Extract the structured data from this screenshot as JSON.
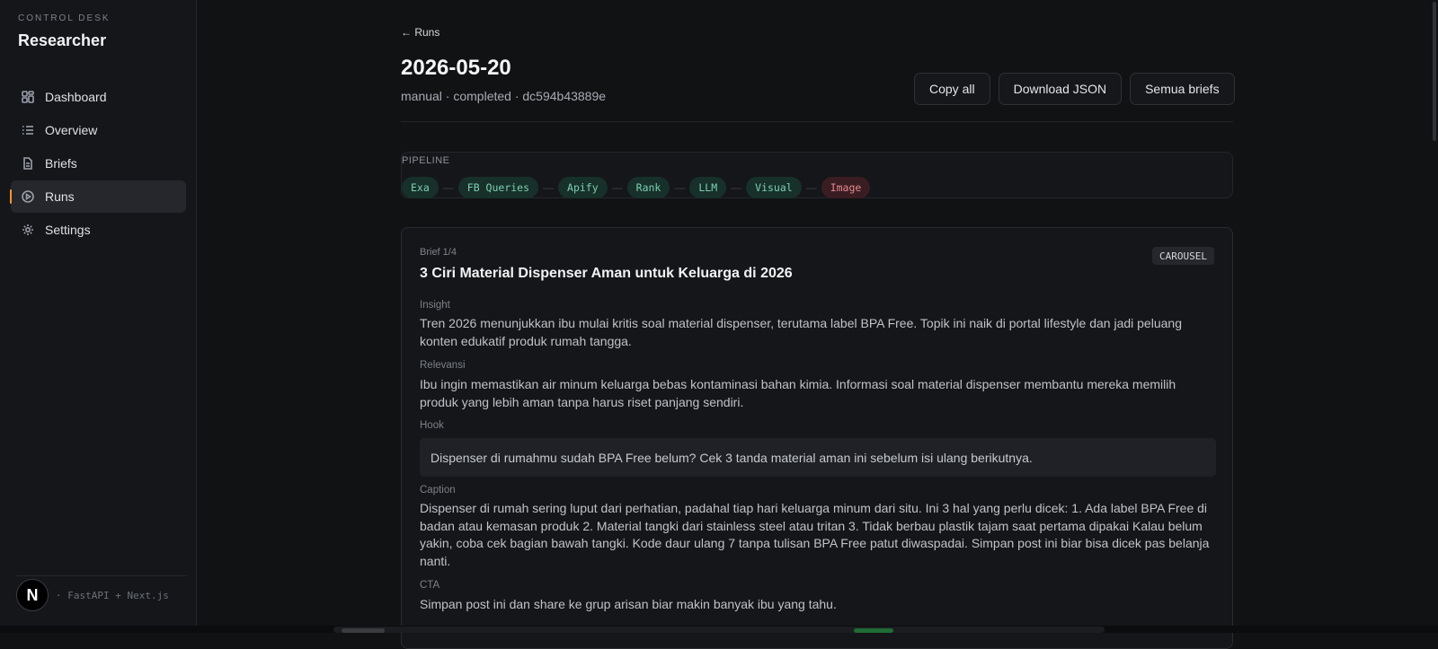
{
  "sidebar": {
    "eyebrow": "CONTROL DESK",
    "title": "Researcher",
    "items": [
      {
        "label": "Dashboard",
        "icon": "dashboard-icon",
        "active": false
      },
      {
        "label": "Overview",
        "icon": "list-icon",
        "active": false
      },
      {
        "label": "Briefs",
        "icon": "document-icon",
        "active": false
      },
      {
        "label": "Runs",
        "icon": "play-circle-icon",
        "active": true
      },
      {
        "label": "Settings",
        "icon": "gear-icon",
        "active": false
      }
    ],
    "footer_logo": "N",
    "footer_stack": "· FastAPI + Next.js"
  },
  "header": {
    "back_label": "← Runs",
    "title": "2026-05-20",
    "subtitle": "manual · completed · dc594b43889e",
    "actions": {
      "copy_all": "Copy all",
      "download_json": "Download JSON",
      "all_briefs": "Semua briefs"
    }
  },
  "pipeline": {
    "label": "PIPELINE",
    "steps": [
      {
        "label": "Exa",
        "status": "ok"
      },
      {
        "label": "FB Queries",
        "status": "ok"
      },
      {
        "label": "Apify",
        "status": "ok"
      },
      {
        "label": "Rank",
        "status": "ok"
      },
      {
        "label": "LLM",
        "status": "ok"
      },
      {
        "label": "Visual",
        "status": "ok"
      },
      {
        "label": "Image",
        "status": "error"
      }
    ],
    "separator": "—"
  },
  "brief": {
    "number": "Brief 1/4",
    "format": "CAROUSEL",
    "title": "3 Ciri Material Dispenser Aman untuk Keluarga di 2026",
    "insight_label": "Insight",
    "insight": "Tren 2026 menunjukkan ibu mulai kritis soal material dispenser, terutama label BPA Free. Topik ini naik di portal lifestyle dan jadi peluang konten edukatif produk rumah tangga.",
    "relevance_label": "Relevansi",
    "relevance": "Ibu ingin memastikan air minum keluarga bebas kontaminasi bahan kimia. Informasi soal material dispenser membantu mereka memilih produk yang lebih aman tanpa harus riset panjang sendiri.",
    "hook_label": "Hook",
    "hook": "Dispenser di rumahmu sudah BPA Free belum? Cek 3 tanda material aman ini sebelum isi ulang berikutnya.",
    "caption_label": "Caption",
    "caption": "Dispenser di rumah sering luput dari perhatian, padahal tiap hari keluarga minum dari situ. Ini 3 hal yang perlu dicek: 1. Ada label BPA Free di badan atau kemasan produk 2. Material tangki dari stainless steel atau tritan 3. Tidak berbau plastik tajam saat pertama dipakai Kalau belum yakin, coba cek bagian bawah tangki. Kode daur ulang 7 tanpa tulisan BPA Free patut diwaspadai. Simpan post ini biar bisa dicek pas belanja nanti.",
    "cta_label": "CTA",
    "cta": "Simpan post ini dan share ke grup arisan biar makin banyak ibu yang tahu."
  },
  "colors": {
    "accent": "#f0982c",
    "chip_ok_bg": "#17302a",
    "chip_ok_text": "#7ccfb0",
    "chip_err_bg": "#3a1d22",
    "chip_err_text": "#e08a8f"
  }
}
